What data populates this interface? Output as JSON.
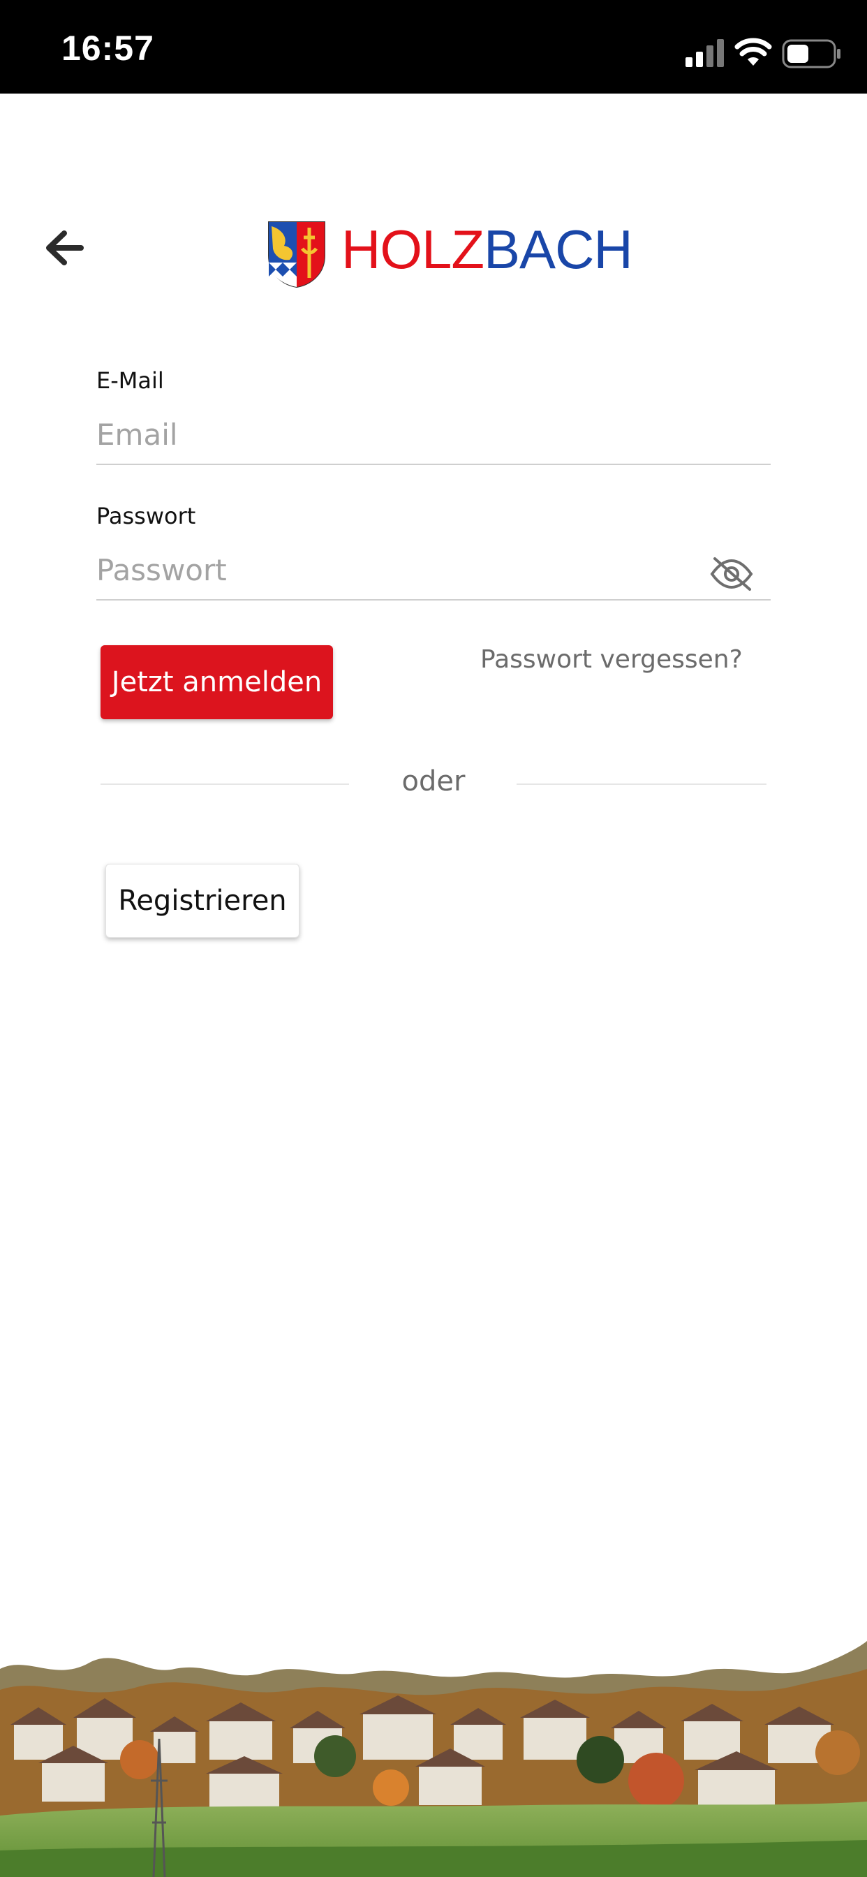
{
  "status_bar": {
    "time": "16:57",
    "icons": [
      "cellular-signal-icon",
      "wifi-icon",
      "battery-icon"
    ]
  },
  "header": {
    "back_icon": "arrow-left-icon",
    "logo": {
      "name_part_1": "HOLZ",
      "name_part_2": "BACH",
      "color_part_1": "#e3111a",
      "color_part_2": "#1946a8"
    }
  },
  "form": {
    "email": {
      "label": "E-Mail",
      "placeholder": "Email",
      "value": ""
    },
    "password": {
      "label": "Passwort",
      "placeholder": "Passwort",
      "value": "",
      "toggle_icon": "eye-off-icon"
    },
    "login_label": "Jetzt anmelden",
    "forgot_label": "Passwort vergessen?",
    "divider_label": "oder",
    "register_label": "Registrieren"
  },
  "colors": {
    "accent_red": "#dc141e",
    "brand_blue": "#1946a8",
    "muted_text": "#6b6b6b"
  },
  "footer": {
    "image": "village-landscape-photo"
  }
}
